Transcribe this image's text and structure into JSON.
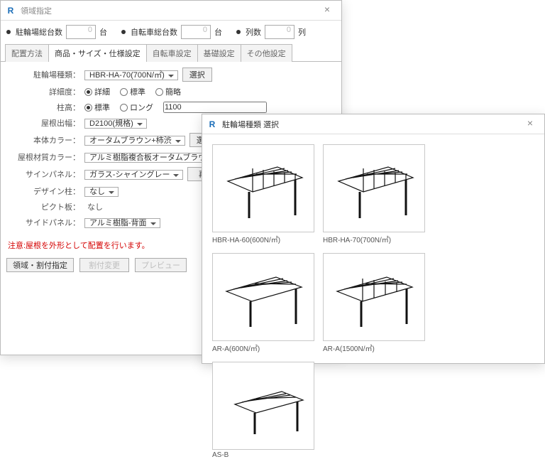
{
  "win1": {
    "title": "領域指定",
    "top": {
      "l1": "駐輪場総台数",
      "v1": "0",
      "u1": "台",
      "l2": "自転車総台数",
      "v2": "0",
      "u2": "台",
      "l3": "列数",
      "v3": "0",
      "u3": "列"
    },
    "tabs": [
      "配置方法",
      "商品・サイズ・仕様設定",
      "自転車設定",
      "基礎設定",
      "その他設定"
    ],
    "activeTab": 1,
    "form": {
      "kind_l": "駐輪場種類：",
      "kind_v": "HBR-HA-70(700N/㎡)",
      "select_btn": "選択",
      "detail_l": "詳細度：",
      "detail_opts": [
        "詳細",
        "標準",
        "簡略"
      ],
      "detail_sel": 0,
      "post_l": "柱高：",
      "post_opts": [
        "標準",
        "ロング"
      ],
      "post_sel": 0,
      "post_val": "1100",
      "roof_l": "屋根出幅：",
      "roof_v": "D2100(規格)",
      "body_l": "本体カラー：",
      "body_v": "オータムブラウン+柿渋",
      "body_btn": "選択",
      "mat_l": "屋根材質カラー：",
      "mat_v": "アルミ樹脂複合板オータムブラウン",
      "sign_l": "サインパネル：",
      "sign_v": "ガラス-シャイングレー",
      "sign_btn": "再",
      "design_l": "デザイン柱：",
      "design_v": "なし",
      "picto_l": "ピクト板：",
      "picto_v": "なし",
      "side_l": "サイドパネル：",
      "side_v": "アルミ樹脂-背面"
    },
    "warning": "注意:屋根を外形として配置を行います。",
    "buttons": [
      "領域・割付指定",
      "割付変更",
      "プレビュー"
    ]
  },
  "win2": {
    "title": "駐輪場種類 選択",
    "items": [
      {
        "cap": "HBR-HA-60(600N/㎡)"
      },
      {
        "cap": "HBR-HA-70(700N/㎡)"
      },
      {
        "cap": "AR-A(600N/㎡)"
      },
      {
        "cap": "AR-A(1500N/㎡)"
      },
      {
        "cap": "AS-B"
      }
    ]
  }
}
